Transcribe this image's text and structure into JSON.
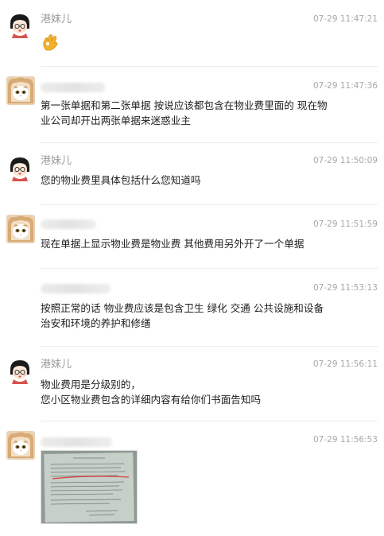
{
  "messages": [
    {
      "sender": "港妹儿",
      "time": "07-29 11:47:21",
      "text": "",
      "emoji": "ok-hand"
    },
    {
      "sender": "",
      "time": "07-29 11:47:36",
      "text": "第一张单据和第二张单据 按说应该都包含在物业费里面的 现在物\n业公司却开出两张单据来迷惑业主"
    },
    {
      "sender": "港妹儿",
      "time": "07-29 11:50:09",
      "text": "您的物业费里具体包括什么您知道吗"
    },
    {
      "sender": "",
      "time": "07-29 11:51:59",
      "text": "现在单据上显示物业费是物业费 其他费用另外开了一个单据"
    },
    {
      "sender": "",
      "time": "07-29 11:53:13",
      "text": "按照正常的话 物业费应该是包含卫生 绿化 交通 公共设施和设备\n治安和环境的养护和修缮"
    },
    {
      "sender": "港妹儿",
      "time": "07-29 11:56:11",
      "text": "物业费用是分级别的，\n您小区物业费包含的详细内容有给你们书面告知吗"
    },
    {
      "sender": "",
      "time": "07-29 11:56:53",
      "text": "",
      "attachment": "document-photo"
    }
  ],
  "colors": {
    "name": "#9a9a9a",
    "time": "#a8a8a8",
    "text": "#1e1e1e",
    "divider": "#ececec",
    "ok_emoji": "#f5b22b"
  }
}
